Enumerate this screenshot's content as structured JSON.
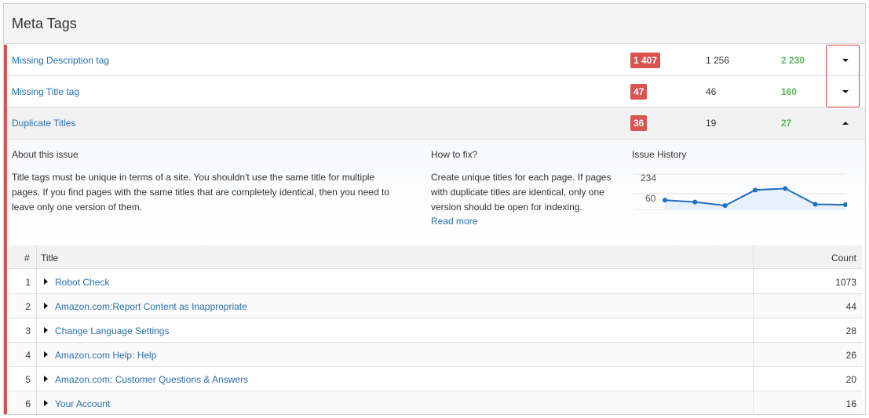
{
  "panel": {
    "title": "Meta Tags"
  },
  "issues": [
    {
      "name": "Missing Description tag",
      "errors": "1 407",
      "pages": "1 256",
      "total": "2 230",
      "toggle_icon": "caret-down"
    },
    {
      "name": "Missing Title tag",
      "errors": "47",
      "pages": "46",
      "total": "160",
      "toggle_icon": "caret-down"
    },
    {
      "name": "Duplicate Titles",
      "errors": "36",
      "pages": "19",
      "total": "27",
      "toggle_icon": "caret-up"
    }
  ],
  "details": {
    "about": {
      "heading": "About this issue",
      "lines": [
        "Title tags must be unique in terms of a site. You shouldn't use the same title for multiple",
        "pages. If you find pages with the same titles that are completely identical, then you need to",
        "leave only one version of them."
      ]
    },
    "fix": {
      "heading": "How to fix?",
      "lines": [
        "Create unique titles for each page. If pages",
        "with duplicate titles are identical, only one",
        "version should be open for indexing."
      ],
      "read_more": "Read more"
    },
    "history": {
      "heading": "Issue History",
      "tick_labels": [
        "234",
        "60"
      ]
    }
  },
  "chart_data": {
    "type": "line",
    "title": "Issue History",
    "ytick_labels": [
      "234",
      "60"
    ],
    "series": [
      {
        "values": [
          65,
          52,
          27,
          137,
          148,
          36,
          33
        ]
      }
    ],
    "ylim": [
      0,
      250
    ],
    "grid": true,
    "line_color": "#1f6fc0",
    "fill_color": "#e8f0fb"
  },
  "table": {
    "headers": {
      "num": "#",
      "title": "Title",
      "count": "Count"
    },
    "rows": [
      {
        "num": "1",
        "title": "Robot Check",
        "count": "1073"
      },
      {
        "num": "2",
        "title": "Amazon.com:Report Content as Inappropriate",
        "count": "44"
      },
      {
        "num": "3",
        "title": "Change Language Settings",
        "count": "28"
      },
      {
        "num": "4",
        "title": "Amazon.com Help: Help",
        "count": "26"
      },
      {
        "num": "5",
        "title": "Amazon.com: Customer Questions & Answers",
        "count": "20"
      },
      {
        "num": "6",
        "title": "Your Account",
        "count": "16"
      }
    ]
  },
  "colors": {
    "accent_red": "#d9534f",
    "link_blue": "#2a6fb0",
    "green": "#5cb85c"
  }
}
